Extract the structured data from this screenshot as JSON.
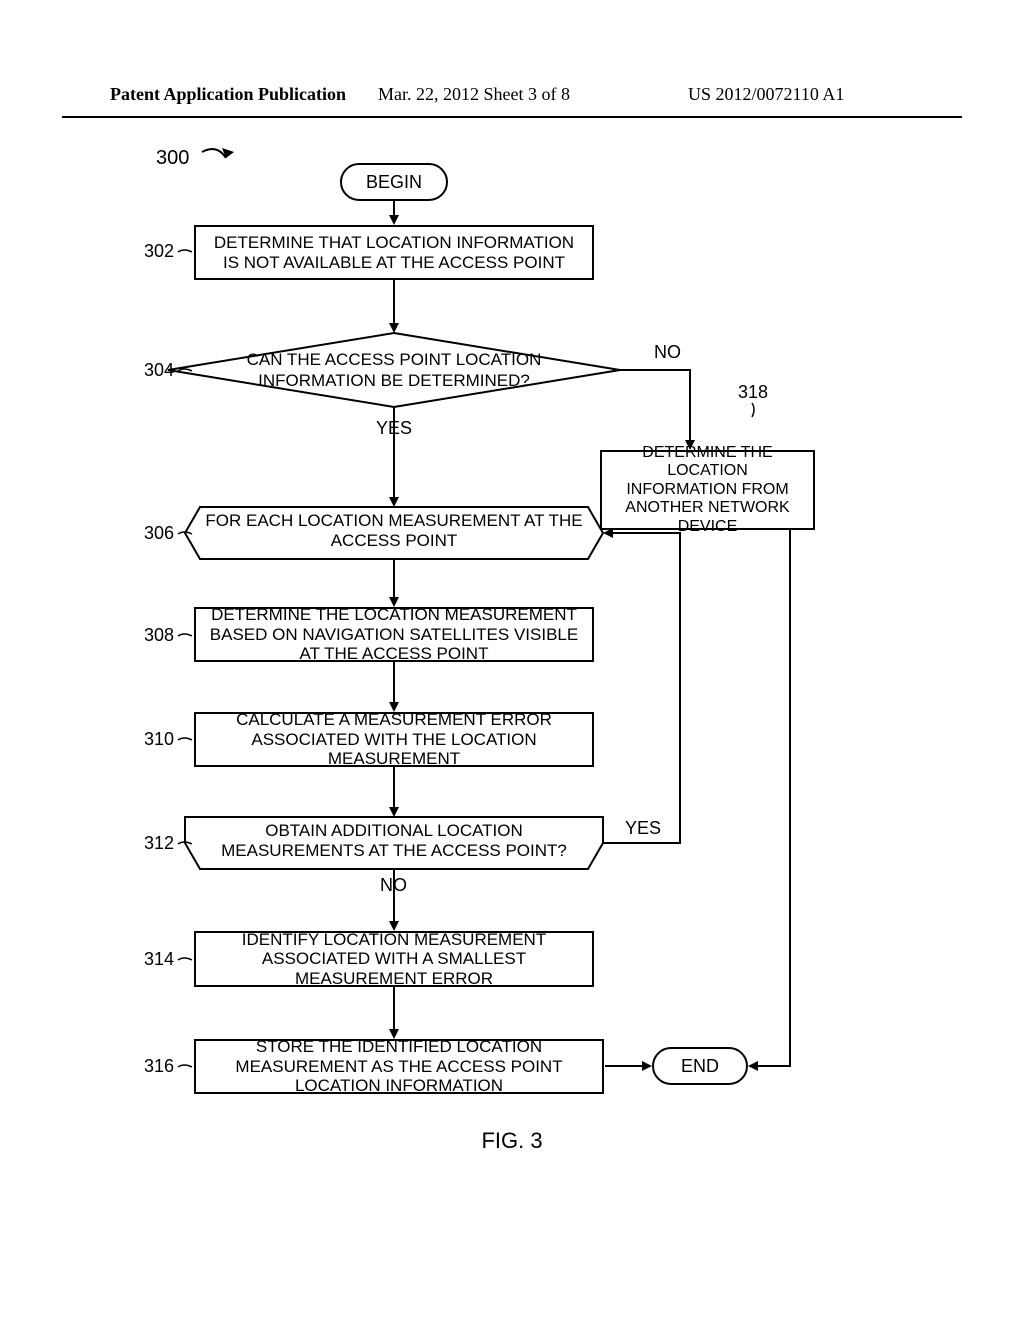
{
  "header": {
    "left": "Patent Application Publication",
    "center": "Mar. 22, 2012  Sheet 3 of 8",
    "right": "US 2012/0072110 A1"
  },
  "flow_ref": "300",
  "begin": "BEGIN",
  "end": "END",
  "steps": {
    "s302": {
      "num": "302",
      "text": "DETERMINE THAT LOCATION INFORMATION IS NOT AVAILABLE AT THE ACCESS POINT"
    },
    "s304": {
      "num": "304",
      "text": "CAN THE ACCESS POINT LOCATION INFORMATION BE DETERMINED?"
    },
    "s306": {
      "num": "306",
      "text": "FOR EACH LOCATION MEASUREMENT AT THE ACCESS POINT"
    },
    "s308": {
      "num": "308",
      "text": "DETERMINE THE LOCATION MEASUREMENT BASED ON NAVIGATION SATELLITES VISIBLE AT THE ACCESS POINT"
    },
    "s310": {
      "num": "310",
      "text": "CALCULATE A MEASUREMENT ERROR ASSOCIATED WITH THE LOCATION MEASUREMENT"
    },
    "s312": {
      "num": "312",
      "text": "OBTAIN ADDITIONAL LOCATION MEASUREMENTS AT THE ACCESS POINT?"
    },
    "s314": {
      "num": "314",
      "text": "IDENTIFY LOCATION MEASUREMENT ASSOCIATED WITH A SMALLEST MEASUREMENT ERROR"
    },
    "s316": {
      "num": "316",
      "text": "STORE THE IDENTIFIED LOCATION MEASUREMENT AS THE ACCESS POINT LOCATION INFORMATION"
    },
    "s318": {
      "num": "318",
      "text": "DETERMINE THE LOCATION INFORMATION FROM ANOTHER NETWORK DEVICE"
    }
  },
  "branch_labels": {
    "yes": "YES",
    "no": "NO"
  },
  "figure_label": "FIG. 3"
}
